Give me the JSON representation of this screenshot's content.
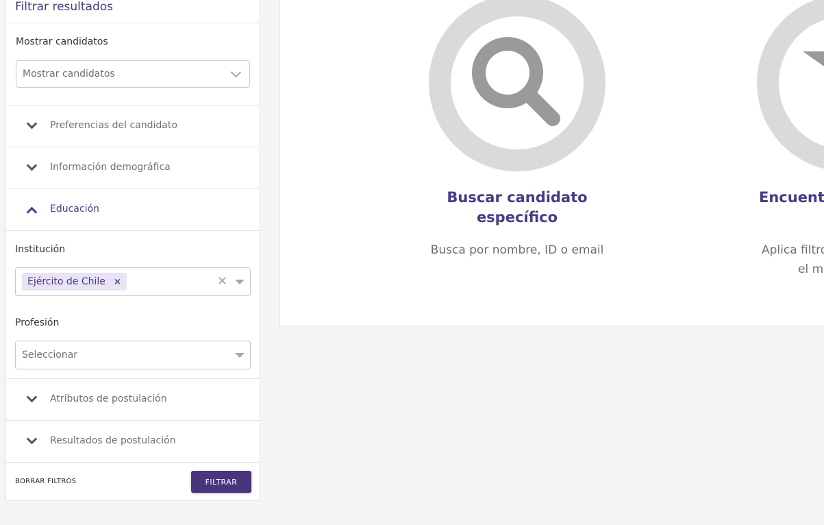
{
  "sidebar": {
    "title": "Filtrar resultados",
    "show_label": "Mostrar candidatos",
    "show_select_value": "Mostrar candidatos",
    "accordions": {
      "preferences": "Preferencias del candidato",
      "demographics": "Información demográfica",
      "education": "Educación",
      "application_attributes": "Atributos de postulación",
      "application_results": "Resultados de postulación"
    },
    "education": {
      "institution_label": "Institución",
      "institution_chip": "Ejército de Chile",
      "chip_remove": "×",
      "clear_all": "✕",
      "profession_label": "Profesión",
      "profession_placeholder": "Seleccionar"
    },
    "clear_filters": "BORRAR FILTROS",
    "filter_button": "FILTRAR"
  },
  "main": {
    "options": [
      {
        "title_line1": "Buscar candidato",
        "title_line2": "específico",
        "description": "Busca por nombre, ID o email",
        "icon": "search-icon"
      },
      {
        "title_line1": "Encuentr",
        "description_line1": "Aplica filtro",
        "description_line2": "el mo",
        "icon": "filter-icon"
      }
    ]
  },
  "colors": {
    "accent": "#4a3a86",
    "button": "#48357e",
    "icon_ring": "#dadada",
    "icon_fill": "#9a9a9a"
  }
}
